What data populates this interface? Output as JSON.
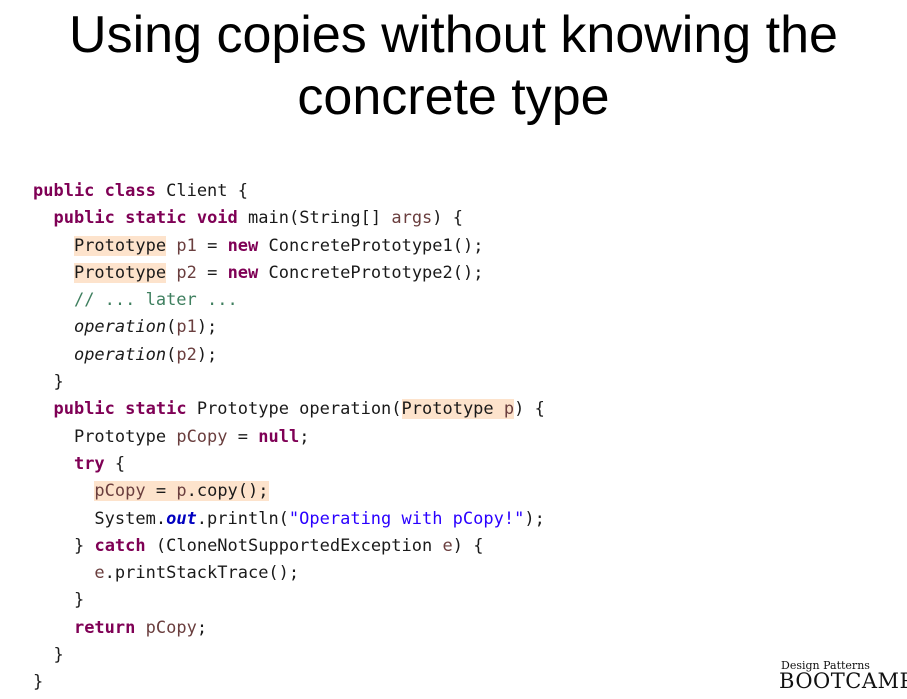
{
  "slide": {
    "title_line1": "Using copies without knowing the",
    "title_line2": "concrete type"
  },
  "code": {
    "l1": {
      "kw1": "public",
      "kw2": "class",
      "rest": "Client {"
    },
    "l2": {
      "kw1": "public",
      "kw2": "static",
      "kw3": "void",
      "rest": "main(String[]",
      "param": "args",
      "end": ") {"
    },
    "l3": {
      "type": "Prototype",
      "var": "p1",
      "eq": "=",
      "kw": "new",
      "rest": "ConcretePrototype1();"
    },
    "l4": {
      "type": "Prototype",
      "var": "p2",
      "eq": "=",
      "kw": "new",
      "rest": "ConcretePrototype2();"
    },
    "l5": {
      "comment": "// ... later ..."
    },
    "l6": {
      "call": "operation",
      "open": "(",
      "var": "p1",
      "close": ");"
    },
    "l7": {
      "call": "operation",
      "open": "(",
      "var": "p2",
      "close": ");"
    },
    "l8": {
      "brace": "}"
    },
    "l9": {
      "kw1": "public",
      "kw2": "static",
      "rest": "Prototype operation(",
      "hl_type": "Prototype",
      "hl_var": "p",
      "end": ") {"
    },
    "l10": {
      "type": "Prototype",
      "var": "pCopy",
      "eq": "=",
      "kw": "null",
      "end": ";"
    },
    "l11": {
      "kw": "try",
      "end": "{"
    },
    "l12": {
      "var1": "pCopy",
      "eq": "=",
      "var2": "p",
      "rest": ".copy();"
    },
    "l13": {
      "start": "System.",
      "field": "out",
      "mid": ".println(",
      "str": "\"Operating with pCopy!\"",
      "end": ");"
    },
    "l14": {
      "start": "}",
      "kw": "catch",
      "mid": "(CloneNotSupportedException",
      "var": "e",
      "end": ") {"
    },
    "l15": {
      "var": "e",
      "rest": ".printStackTrace();"
    },
    "l16": {
      "brace": "}"
    },
    "l17": {
      "kw": "return",
      "var": "pCopy",
      "end": ";"
    },
    "l18": {
      "brace": "}"
    },
    "l19": {
      "brace": "}"
    }
  },
  "colors": {
    "keyword": "#7f0055",
    "local_variable": "#6a3e3e",
    "comment": "#3f7f5f",
    "string": "#2a00ff",
    "static_field": "#0000c0",
    "highlight": "#fde3cc"
  },
  "logo": {
    "small_text": "Design Patterns",
    "big_text": "BOOTCAMP"
  }
}
